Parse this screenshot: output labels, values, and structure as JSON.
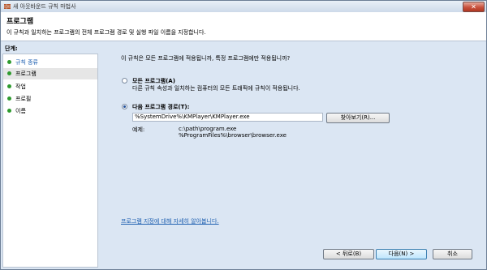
{
  "window": {
    "title": "새 아웃바운드 규칙 마법사",
    "close_label": "✕"
  },
  "header": {
    "title": "프로그램",
    "description": "이 규칙과 일치하는 프로그램의 전체 프로그램 경로 및 실행 파일 이름을 지정합니다."
  },
  "sidebar": {
    "label": "단계:",
    "items": [
      {
        "label": "규칙 종류"
      },
      {
        "label": "프로그램"
      },
      {
        "label": "작업"
      },
      {
        "label": "프로필"
      },
      {
        "label": "이름"
      }
    ]
  },
  "main": {
    "question": "이 규칙은 모든 프로그램에 적용됩니까, 특정 프로그램에만 적용됩니까?",
    "option_all": {
      "title": "모든 프로그램(A)",
      "description": "다른 규칙 속성과 일치하는 컴퓨터의 모든 트래픽에 규칙이 적용됩니다."
    },
    "option_path": {
      "title": "다음 프로그램 경로(T):",
      "value": "%SystemDrive%\\KMPlayer\\KMPlayer.exe",
      "browse_label": "찾아보기(R)...",
      "example_label": "예제:",
      "example_lines": [
        "c:\\path\\program.exe",
        "%ProgramFiles%\\browser\\browser.exe"
      ]
    },
    "help_link": "프로그램 지정에 대해 자세히 알아봅니다."
  },
  "buttons": {
    "back": "< 뒤로(B)",
    "next": "다음(N) >",
    "cancel": "취소"
  },
  "colors": {
    "accent": "#1f4f9a",
    "link": "#1d5fb0",
    "bullet": "#2e9b2e",
    "close": "#c8503c"
  }
}
